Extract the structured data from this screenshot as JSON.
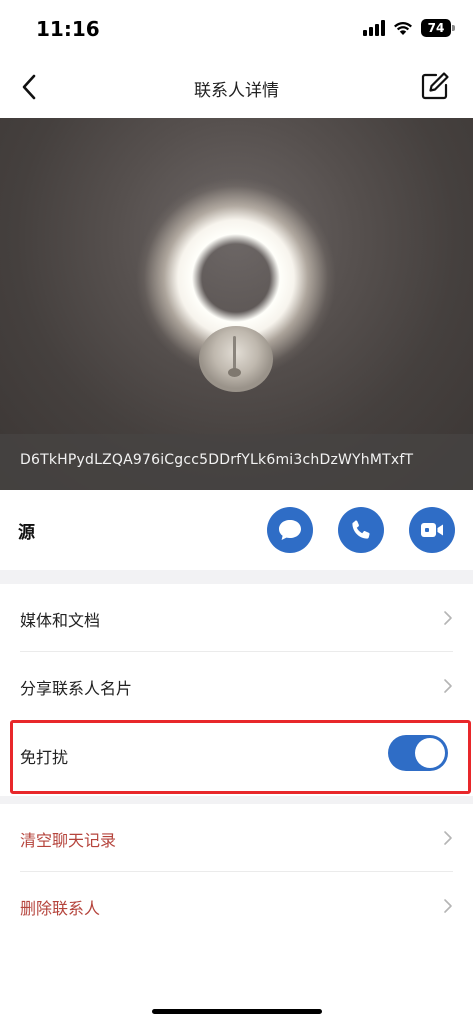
{
  "status_bar": {
    "time": "11:16",
    "battery": "74"
  },
  "nav": {
    "title": "联系人详情",
    "back_icon": "chevron-left-icon",
    "edit_icon": "edit-icon"
  },
  "hero": {
    "contact_id": "D6TkHPydLZQA976iCgcc5DDrfYLk6mi3chDzWYhMTxfT"
  },
  "contact": {
    "name": "源"
  },
  "actions": [
    {
      "icon": "chat-bubble-icon"
    },
    {
      "icon": "phone-icon"
    },
    {
      "icon": "video-camera-icon"
    }
  ],
  "menu": {
    "media_docs": "媒体和文档",
    "share_card": "分享联系人名片",
    "do_not_disturb": "免打扰",
    "do_not_disturb_on": true,
    "clear_history": "清空聊天记录",
    "delete_contact": "删除联系人"
  },
  "colors": {
    "accent": "#2f6dc6",
    "danger_text": "#b5443c",
    "highlight_border": "#e8272a",
    "section_gap": "#f2f2f4"
  }
}
